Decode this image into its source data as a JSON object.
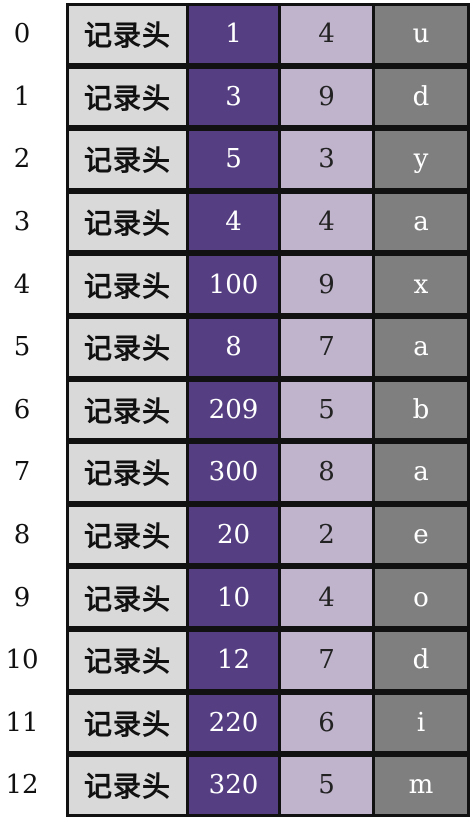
{
  "colors": {
    "header_cell": "#d9d9d9",
    "number_cell": "#553f82",
    "small_number_cell": "#c0b4cc",
    "letter_cell": "#7f7f7f",
    "border": "#111111"
  },
  "rows": [
    {
      "index": "0",
      "header": "记录头",
      "number": "1",
      "small": "4",
      "letter": "u"
    },
    {
      "index": "1",
      "header": "记录头",
      "number": "3",
      "small": "9",
      "letter": "d"
    },
    {
      "index": "2",
      "header": "记录头",
      "number": "5",
      "small": "3",
      "letter": "y"
    },
    {
      "index": "3",
      "header": "记录头",
      "number": "4",
      "small": "4",
      "letter": "a"
    },
    {
      "index": "4",
      "header": "记录头",
      "number": "100",
      "small": "9",
      "letter": "x"
    },
    {
      "index": "5",
      "header": "记录头",
      "number": "8",
      "small": "7",
      "letter": "a"
    },
    {
      "index": "6",
      "header": "记录头",
      "number": "209",
      "small": "5",
      "letter": "b"
    },
    {
      "index": "7",
      "header": "记录头",
      "number": "300",
      "small": "8",
      "letter": "a"
    },
    {
      "index": "8",
      "header": "记录头",
      "number": "20",
      "small": "2",
      "letter": "e"
    },
    {
      "index": "9",
      "header": "记录头",
      "number": "10",
      "small": "4",
      "letter": "o"
    },
    {
      "index": "10",
      "header": "记录头",
      "number": "12",
      "small": "7",
      "letter": "d"
    },
    {
      "index": "11",
      "header": "记录头",
      "number": "220",
      "small": "6",
      "letter": "i"
    },
    {
      "index": "12",
      "header": "记录头",
      "number": "320",
      "small": "5",
      "letter": "m"
    }
  ]
}
